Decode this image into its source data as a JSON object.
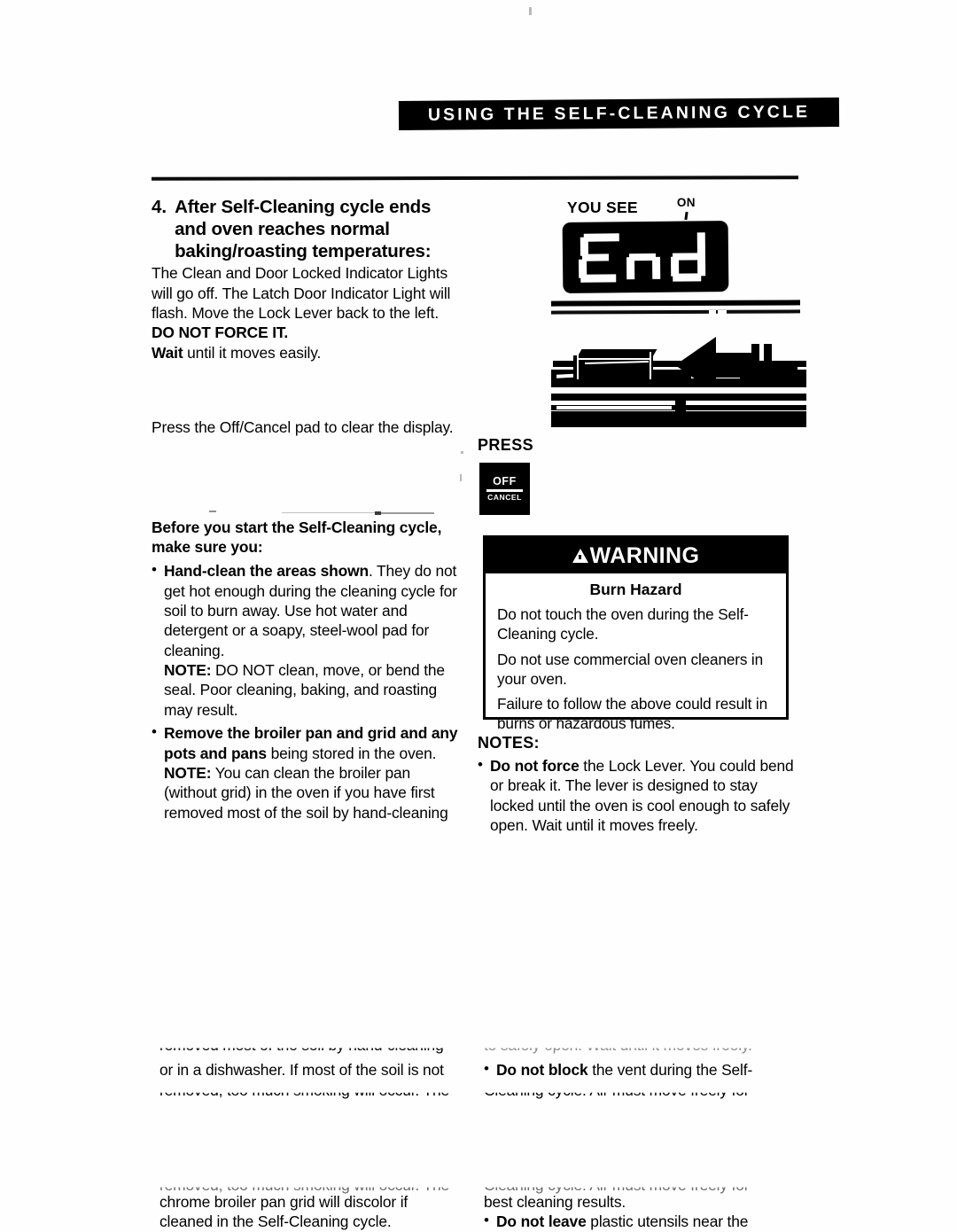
{
  "header": {
    "banner_title": "USING THE SELF-CLEANING CYCLE"
  },
  "left_column": {
    "step": {
      "number": "4.",
      "heading": "After Self-Cleaning cycle ends and oven reaches normal baking/roasting temperatures:",
      "body_1": "The Clean and Door Locked Indicator Lights will go off. The Latch Door Indicator Light will flash. Move the Lock Lever back to the left. ",
      "body_1_bold": "DO NOT FORCE IT.",
      "body_2_bold": "Wait",
      "body_2": " until it moves easily."
    },
    "press_instruction": "Press the Off/Cancel pad to clear the display.",
    "before_heading": "Before you start the Self-Cleaning cycle, make sure you:",
    "bullets": [
      {
        "lead": "Hand-clean the areas shown",
        "text": ". They do not get hot enough during the cleaning cycle for soil to burn away. Use hot water and detergent or a soapy, steel-wool pad for cleaning.",
        "note_label": "NOTE:",
        "note_text": " DO NOT clean, move, or bend the seal. Poor cleaning, baking, and roasting may result."
      },
      {
        "lead": "Remove the broiler pan and grid and any pots and pans",
        "text": " being stored in the oven.",
        "note_label": "NOTE:",
        "note_text": " You can clean the broiler pan (without grid) in the oven if you have first removed most of the soil by hand-cleaning"
      }
    ],
    "continued_1": "removed most of the soil by hand-cleaning",
    "continued_2": "or in a dishwasher. If most of the soil is not",
    "continued_3": "removed, too much smoking will occur. The",
    "continued_4": "chrome broiler pan grid will discolor if",
    "continued_5": "cleaned in the Self-Cleaning cycle."
  },
  "right_column": {
    "you_see_label": "YOU SEE",
    "on_label": "ON",
    "display_value": "End",
    "press_label": "PRESS",
    "pad": {
      "off_label": "OFF",
      "cancel_label": "CANCEL"
    },
    "warning": {
      "banner": "WARNING",
      "title": "Burn Hazard",
      "lines": [
        "Do not touch the oven during the Self-Cleaning cycle.",
        "Do not use commercial oven cleaners in your oven.",
        "Failure to follow the above could result in burns or hazardous fumes."
      ]
    },
    "notes_heading": "NOTES:",
    "notes": [
      {
        "lead": "Do not force",
        "text": " the Lock Lever. You could bend or break it. The lever is designed to stay locked until the oven is cool enough to safely open. Wait until it moves freely."
      },
      {
        "lead": "Do not block",
        "text": " the vent during the Self-Cleaning cycle. Air must move freely for best cleaning results."
      },
      {
        "lead": "Do not leave",
        "text": " plastic utensils near the"
      }
    ],
    "continued_1": "to safely open. Wait until it moves freely.",
    "continued_2": "Cleaning cycle. Air must move freely for",
    "continued_3": "best cleaning results."
  },
  "colors": {
    "ink": "#000000",
    "paper": "#fefefe",
    "faded_ink": "#6d6d6d"
  }
}
